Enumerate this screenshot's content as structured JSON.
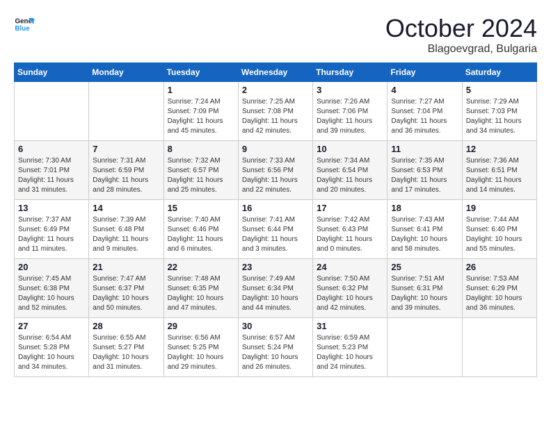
{
  "logo": {
    "line1": "General",
    "line2": "Blue"
  },
  "title": "October 2024",
  "subtitle": "Blagoevgrad, Bulgaria",
  "weekdays": [
    "Sunday",
    "Monday",
    "Tuesday",
    "Wednesday",
    "Thursday",
    "Friday",
    "Saturday"
  ],
  "weeks": [
    [
      {
        "day": "",
        "info": ""
      },
      {
        "day": "",
        "info": ""
      },
      {
        "day": "1",
        "info": "Sunrise: 7:24 AM\nSunset: 7:09 PM\nDaylight: 11 hours\nand 45 minutes."
      },
      {
        "day": "2",
        "info": "Sunrise: 7:25 AM\nSunset: 7:08 PM\nDaylight: 11 hours\nand 42 minutes."
      },
      {
        "day": "3",
        "info": "Sunrise: 7:26 AM\nSunset: 7:06 PM\nDaylight: 11 hours\nand 39 minutes."
      },
      {
        "day": "4",
        "info": "Sunrise: 7:27 AM\nSunset: 7:04 PM\nDaylight: 11 hours\nand 36 minutes."
      },
      {
        "day": "5",
        "info": "Sunrise: 7:29 AM\nSunset: 7:03 PM\nDaylight: 11 hours\nand 34 minutes."
      }
    ],
    [
      {
        "day": "6",
        "info": "Sunrise: 7:30 AM\nSunset: 7:01 PM\nDaylight: 11 hours\nand 31 minutes."
      },
      {
        "day": "7",
        "info": "Sunrise: 7:31 AM\nSunset: 6:59 PM\nDaylight: 11 hours\nand 28 minutes."
      },
      {
        "day": "8",
        "info": "Sunrise: 7:32 AM\nSunset: 6:57 PM\nDaylight: 11 hours\nand 25 minutes."
      },
      {
        "day": "9",
        "info": "Sunrise: 7:33 AM\nSunset: 6:56 PM\nDaylight: 11 hours\nand 22 minutes."
      },
      {
        "day": "10",
        "info": "Sunrise: 7:34 AM\nSunset: 6:54 PM\nDaylight: 11 hours\nand 20 minutes."
      },
      {
        "day": "11",
        "info": "Sunrise: 7:35 AM\nSunset: 6:53 PM\nDaylight: 11 hours\nand 17 minutes."
      },
      {
        "day": "12",
        "info": "Sunrise: 7:36 AM\nSunset: 6:51 PM\nDaylight: 11 hours\nand 14 minutes."
      }
    ],
    [
      {
        "day": "13",
        "info": "Sunrise: 7:37 AM\nSunset: 6:49 PM\nDaylight: 11 hours\nand 11 minutes."
      },
      {
        "day": "14",
        "info": "Sunrise: 7:39 AM\nSunset: 6:48 PM\nDaylight: 11 hours\nand 9 minutes."
      },
      {
        "day": "15",
        "info": "Sunrise: 7:40 AM\nSunset: 6:46 PM\nDaylight: 11 hours\nand 6 minutes."
      },
      {
        "day": "16",
        "info": "Sunrise: 7:41 AM\nSunset: 6:44 PM\nDaylight: 11 hours\nand 3 minutes."
      },
      {
        "day": "17",
        "info": "Sunrise: 7:42 AM\nSunset: 6:43 PM\nDaylight: 11 hours\nand 0 minutes."
      },
      {
        "day": "18",
        "info": "Sunrise: 7:43 AM\nSunset: 6:41 PM\nDaylight: 10 hours\nand 58 minutes."
      },
      {
        "day": "19",
        "info": "Sunrise: 7:44 AM\nSunset: 6:40 PM\nDaylight: 10 hours\nand 55 minutes."
      }
    ],
    [
      {
        "day": "20",
        "info": "Sunrise: 7:45 AM\nSunset: 6:38 PM\nDaylight: 10 hours\nand 52 minutes."
      },
      {
        "day": "21",
        "info": "Sunrise: 7:47 AM\nSunset: 6:37 PM\nDaylight: 10 hours\nand 50 minutes."
      },
      {
        "day": "22",
        "info": "Sunrise: 7:48 AM\nSunset: 6:35 PM\nDaylight: 10 hours\nand 47 minutes."
      },
      {
        "day": "23",
        "info": "Sunrise: 7:49 AM\nSunset: 6:34 PM\nDaylight: 10 hours\nand 44 minutes."
      },
      {
        "day": "24",
        "info": "Sunrise: 7:50 AM\nSunset: 6:32 PM\nDaylight: 10 hours\nand 42 minutes."
      },
      {
        "day": "25",
        "info": "Sunrise: 7:51 AM\nSunset: 6:31 PM\nDaylight: 10 hours\nand 39 minutes."
      },
      {
        "day": "26",
        "info": "Sunrise: 7:53 AM\nSunset: 6:29 PM\nDaylight: 10 hours\nand 36 minutes."
      }
    ],
    [
      {
        "day": "27",
        "info": "Sunrise: 6:54 AM\nSunset: 5:28 PM\nDaylight: 10 hours\nand 34 minutes."
      },
      {
        "day": "28",
        "info": "Sunrise: 6:55 AM\nSunset: 5:27 PM\nDaylight: 10 hours\nand 31 minutes."
      },
      {
        "day": "29",
        "info": "Sunrise: 6:56 AM\nSunset: 5:25 PM\nDaylight: 10 hours\nand 29 minutes."
      },
      {
        "day": "30",
        "info": "Sunrise: 6:57 AM\nSunset: 5:24 PM\nDaylight: 10 hours\nand 26 minutes."
      },
      {
        "day": "31",
        "info": "Sunrise: 6:59 AM\nSunset: 5:23 PM\nDaylight: 10 hours\nand 24 minutes."
      },
      {
        "day": "",
        "info": ""
      },
      {
        "day": "",
        "info": ""
      }
    ]
  ]
}
